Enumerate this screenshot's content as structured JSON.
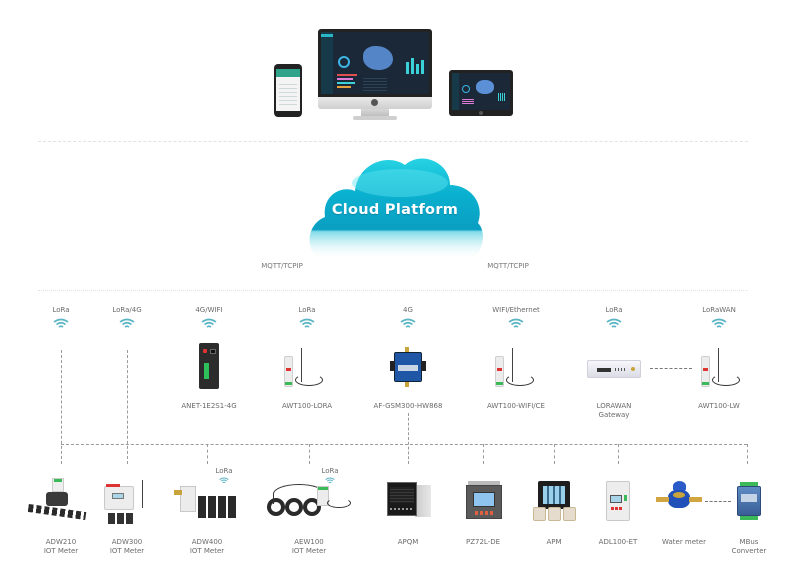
{
  "cloud": {
    "title": "Cloud Platform",
    "protocol_left": "MQTT/TCPIP",
    "protocol_right": "MQTT/TCPIP"
  },
  "terminals": {
    "items": [
      {
        "name": "mobile-phone"
      },
      {
        "name": "desktop-monitor"
      },
      {
        "name": "tablet"
      }
    ]
  },
  "gateways": [
    {
      "protocol": "LoRa",
      "label": ""
    },
    {
      "protocol": "LoRa/4G",
      "label": ""
    },
    {
      "protocol": "4G/WIFI",
      "label": "ANET-1E2S1-4G"
    },
    {
      "protocol": "LoRa",
      "label": "AWT100-LORA"
    },
    {
      "protocol": "4G",
      "label": "AF-GSM300-HW868"
    },
    {
      "protocol": "WIFI/Ethernet",
      "label": "AWT100-WIFI/CE"
    },
    {
      "protocol": "LoRa",
      "label": "LORAWAN",
      "label2": "Gateway"
    },
    {
      "protocol": "LoRaWAN",
      "label": "AWT100-LW"
    }
  ],
  "meters": [
    {
      "label": "ADW210",
      "label2": "IOT  Meter",
      "protocol": ""
    },
    {
      "label": "ADW300",
      "label2": "IOT  Meter",
      "protocol": ""
    },
    {
      "label": "ADW400",
      "label2": "IOT  Meter",
      "protocol": "LoRa"
    },
    {
      "label": "AEW100",
      "label2": "IOT  Meter",
      "protocol": "LoRa"
    },
    {
      "label": "APQM",
      "label2": "",
      "protocol": ""
    },
    {
      "label": "PZ72L-DE",
      "label2": "",
      "protocol": ""
    },
    {
      "label": "APM",
      "label2": "",
      "protocol": ""
    },
    {
      "label": "ADL100-ET",
      "label2": "",
      "protocol": ""
    },
    {
      "label": "Water meter",
      "label2": "",
      "protocol": ""
    },
    {
      "label": "MBus",
      "label2": "Converter",
      "protocol": ""
    }
  ],
  "colors": {
    "cloud_top": "#1bc4dc",
    "cloud_body": "#0aa1c4",
    "wifi": "#59b4c4",
    "bus_line": "#9a9a9a"
  }
}
